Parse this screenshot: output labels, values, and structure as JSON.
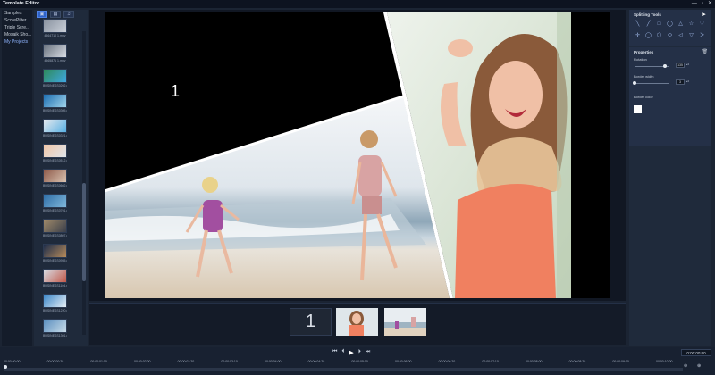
{
  "window": {
    "title": "Template Editor",
    "controls": [
      "—",
      "▫",
      "✕"
    ]
  },
  "categories": [
    {
      "label": "Samples",
      "active": false
    },
    {
      "label": "ScorePilter...",
      "active": false
    },
    {
      "label": "Triple Scre...",
      "active": false
    },
    {
      "label": "Mosaik Sho...",
      "active": false
    },
    {
      "label": "My Projects",
      "active": true
    }
  ],
  "library": {
    "tools": [
      "▣",
      "▤",
      "♫"
    ],
    "thumbs": [
      {
        "caption": "4564710 1.mov",
        "c1": "#8a93a0",
        "c2": "#c9cfd8"
      },
      {
        "caption": "4565871 1.mov",
        "c1": "#6a737f",
        "c2": "#d6dbe2"
      },
      {
        "caption": "BUSINESS0202.mov",
        "c1": "#2e8a5a",
        "c2": "#3fa7e0"
      },
      {
        "caption": "BUSINESS0305.mov",
        "c1": "#1d6fb3",
        "c2": "#9fd3ea"
      },
      {
        "caption": "BUSINESS0321.mov",
        "c1": "#e6e9ee",
        "c2": "#58b0e3"
      },
      {
        "caption": "BUSINESS0512.mov",
        "c1": "#f0c6a8",
        "c2": "#dfe4ea"
      },
      {
        "caption": "BUSINESS0602.mov",
        "c1": "#8e5a4a",
        "c2": "#d9c2b0"
      },
      {
        "caption": "BUSINESS0701.mov",
        "c1": "#2f6fa8",
        "c2": "#7fb6d9"
      },
      {
        "caption": "BUSINESS0807.mov",
        "c1": "#a08a6a",
        "c2": "#3a3f4a"
      },
      {
        "caption": "BUSINESS0955.mov",
        "c1": "#1e2d4a",
        "c2": "#b58a5a"
      },
      {
        "caption": "BUSINESS1104.mov",
        "c1": "#d8dde4",
        "c2": "#c2594a"
      },
      {
        "caption": "BUSINESS1220.mov",
        "c1": "#3c87c9",
        "c2": "#e5eef5"
      },
      {
        "caption": "BUSINESS1301.mov",
        "c1": "#5a8fbf",
        "c2": "#c8dbe8"
      }
    ]
  },
  "preview": {
    "slot_number": "1"
  },
  "strip": {
    "slot1_label": "1"
  },
  "splitting_tools": {
    "heading": "Splitting Tools",
    "pointer": "➤",
    "tools": [
      "╲",
      "╱",
      "□",
      "◯",
      "△",
      "☆",
      "♡",
      "✛",
      "◯",
      "⬡",
      "⬭",
      "◁",
      "▽",
      "ᐳ"
    ]
  },
  "properties": {
    "heading": "Properties",
    "rotation_label": "Rotation",
    "rotation_value": "135",
    "rotation_fraction": 0.9,
    "border_width_label": "Border width",
    "border_width_value": "3",
    "border_width_fraction": 0.0,
    "border_color_label": "Border color",
    "border_color": "#ffffff"
  },
  "transport": {
    "buttons": [
      "⏮",
      "⏴",
      "▶",
      "⏵",
      "⏭"
    ],
    "timecode": "0:00:00:00",
    "ruler": [
      "00:00:00:00",
      "00:00:00:20",
      "00:00:01:10",
      "00:00:02:00",
      "00:00:02:20",
      "00:00:03:10",
      "00:00:04:00",
      "00:00:04:20",
      "00:00:05:10",
      "00:00:06:00",
      "00:00:06:20",
      "00:00:07:10",
      "00:00:08:00",
      "00:00:08:20",
      "00:00:09:10",
      "00:00:10:00"
    ],
    "zoom_out": "⊖",
    "zoom_in": "⊕"
  }
}
